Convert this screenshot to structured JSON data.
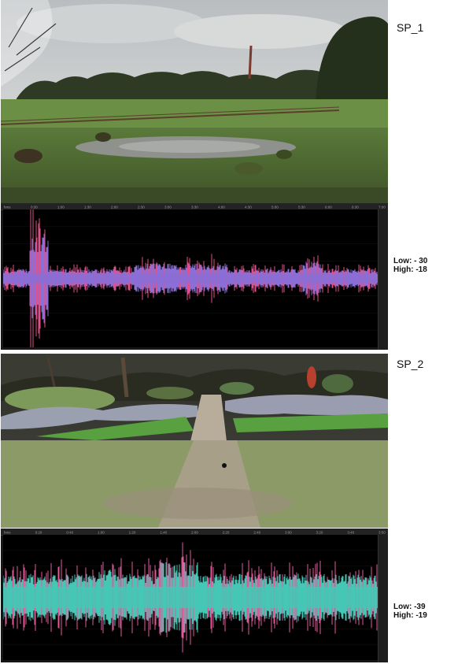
{
  "sp1": {
    "title": "SP_1",
    "low": "Low: - 30",
    "high": "High: -18",
    "ruler": [
      "hms",
      "0:30",
      "1:00",
      "1:30",
      "2:00",
      "2:30",
      "3:00",
      "3:30",
      "4:00",
      "4:30",
      "5:00",
      "5:30",
      "6:00",
      "6:30",
      "7:00"
    ]
  },
  "sp2": {
    "title": "SP_2",
    "low": "Low: -39",
    "high": "High: -19",
    "ruler": [
      "hms",
      "0:20",
      "0:40",
      "1:00",
      "1:20",
      "1:40",
      "2:00",
      "2:20",
      "2:40",
      "3:00",
      "3:20",
      "3:40",
      "3:50"
    ]
  },
  "colors": {
    "sp1_wave": "#8a6fd6",
    "sp1_peaks": "#e0508a",
    "sp2_wave": "#46c7b5",
    "sp2_peaks": "#e05a9a"
  }
}
